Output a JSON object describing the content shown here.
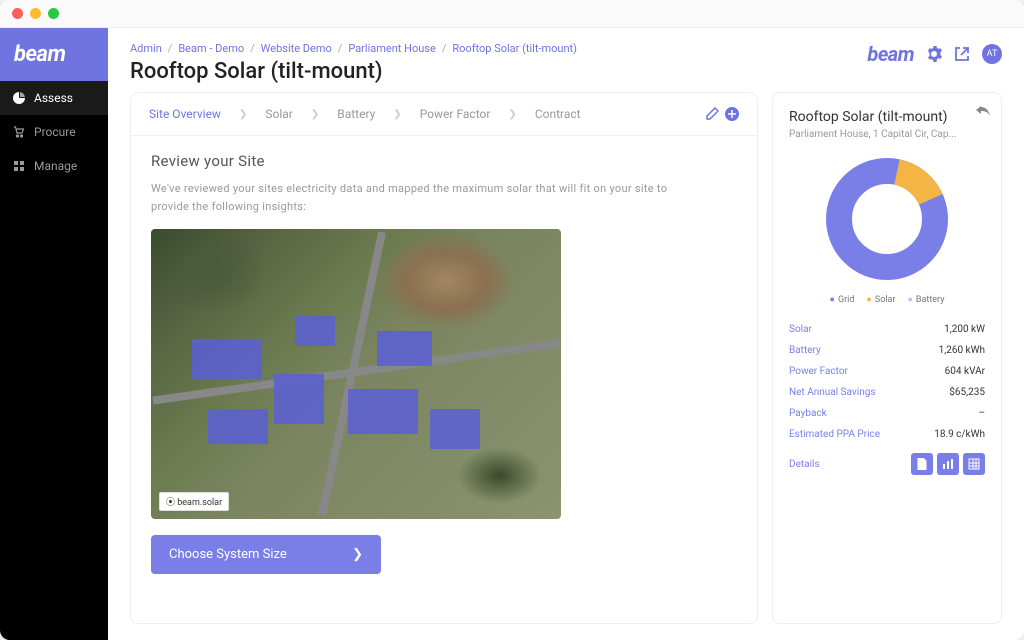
{
  "sidebar": {
    "logo": "beam",
    "items": [
      {
        "label": "Assess",
        "icon": "pie"
      },
      {
        "label": "Procure",
        "icon": "cart"
      },
      {
        "label": "Manage",
        "icon": "grid"
      }
    ]
  },
  "breadcrumbs": [
    "Admin",
    "Beam - Demo",
    "Website Demo",
    "Parliament House",
    "Rooftop Solar (tilt-mount)"
  ],
  "page_title": "Rooftop Solar (tilt-mount)",
  "top_right": {
    "brand": "beam",
    "avatar": "AT"
  },
  "tabs": [
    "Site Overview",
    "Solar",
    "Battery",
    "Power Factor",
    "Contract"
  ],
  "section": {
    "title": "Review your Site",
    "desc": "We've reviewed your sites electricity data and mapped the maximum solar that will fit on your site to provide the following insights:",
    "map_badge": "⦿ beam.solar",
    "cta": "Choose System Size"
  },
  "summary": {
    "title": "Rooftop Solar (tilt-mount)",
    "subtitle": "Parliament House, 1 Capital Cir, Cap...",
    "legend": {
      "grid": "Grid",
      "solar": "Solar",
      "battery": "Battery"
    },
    "stats": [
      {
        "label": "Solar",
        "value": "1,200 kW"
      },
      {
        "label": "Battery",
        "value": "1,260 kWh"
      },
      {
        "label": "Power Factor",
        "value": "604 kVAr"
      },
      {
        "label": "Net Annual Savings",
        "value": "$65,235"
      },
      {
        "label": "Payback",
        "value": "–"
      },
      {
        "label": "Estimated PPA Price",
        "value": "18.9 c/kWh"
      }
    ],
    "details_label": "Details"
  },
  "chart_data": {
    "type": "pie",
    "title": "",
    "series": [
      {
        "name": "Grid",
        "value": 85,
        "color": "#7a7fe8"
      },
      {
        "name": "Solar",
        "value": 15,
        "color": "#f5b544"
      },
      {
        "name": "Battery",
        "value": 0,
        "color": "#b8bef0"
      }
    ]
  }
}
